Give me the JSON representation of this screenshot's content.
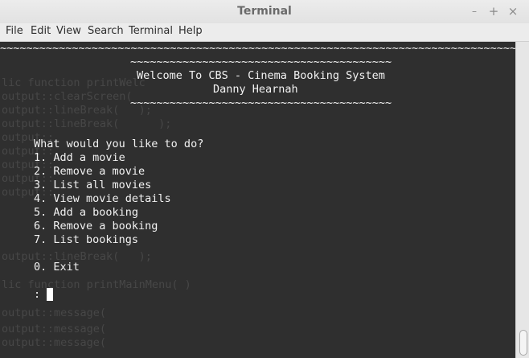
{
  "window": {
    "title": "Terminal",
    "controls": {
      "minimize": "–",
      "maximize": "+",
      "close": "×"
    }
  },
  "menu": [
    "File",
    "Edit",
    "View",
    "Search",
    "Terminal",
    "Help"
  ],
  "terminal": {
    "lines": [
      "~~~~~~~~~~~~~~~~~~~~~~~~~~~~~~~~~~~~~~~~~~~~~~~~~~~~~~~~~~~~~~~~~~~~~~~~~~~~~~~~",
      "~~~~~~~~~~~~~~~~~~~~~~~~~~~~~~~~~~~~~~~~",
      "Welcome To CBS - Cinema Booking System",
      "Danny Hearnah",
      "~~~~~~~~~~~~~~~~~~~~~~~~~~~~~~~~~~~~~~~~",
      "What would you like to do?",
      "1. Add a movie",
      "2. Remove a movie",
      "3. List all movies",
      "4. View movie details",
      "5. Add a booking",
      "6. Remove a booking",
      "7. List bookings",
      "0. Exit",
      ":"
    ],
    "ghost_lines": [
      "lic function printWelc",
      "output::clearScreen(",
      "output::lineBreak(   );",
      "output::lineBreak(      );",
      "output::",
      "output::",
      "output::",
      "output::",
      "output::",
      "output::lineBreak(   );",
      "lic function printMainMenu( )",
      "output::message(",
      "output::message(",
      "output::message("
    ]
  },
  "colors": {
    "terminal_bg": "#2f2f2f",
    "terminal_fg": "#f2f2f2",
    "chrome_bg": "#ececec"
  }
}
